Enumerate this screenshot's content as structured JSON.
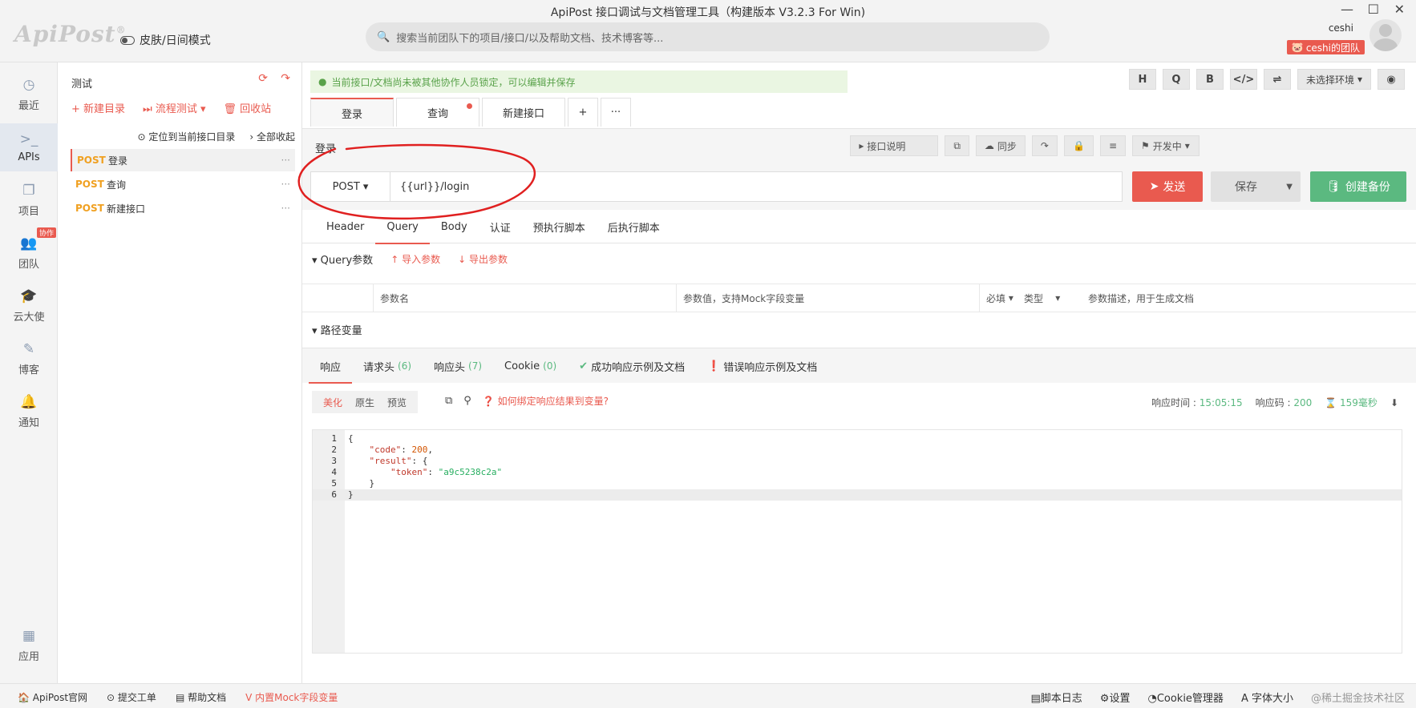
{
  "app": {
    "title": "ApiPost 接口调试与文档管理工具（构建版本 V3.2.3 For Win)",
    "logo": "ApiPost",
    "logo_mark": "®",
    "skin_mode": "皮肤/日间模式",
    "search_placeholder": "搜索当前团队下的项目/接口/以及帮助文档、技术博客等...",
    "user": "ceshi",
    "team_badge": "ceshi的团队",
    "win_controls": [
      "—",
      "☐",
      "✕"
    ]
  },
  "leftnav": {
    "items": [
      {
        "label": "最近",
        "icon": "clock-icon",
        "glyph": "◷"
      },
      {
        "label": "APIs",
        "icon": "terminal-icon",
        "glyph": ">_"
      },
      {
        "label": "项目",
        "icon": "project-icon",
        "glyph": "❐"
      },
      {
        "label": "团队",
        "icon": "team-icon",
        "glyph": "👥"
      },
      {
        "label": "云大使",
        "icon": "graduation-icon",
        "glyph": "🎓"
      },
      {
        "label": "博客",
        "icon": "edit-icon",
        "glyph": "✎"
      },
      {
        "label": "通知",
        "icon": "bell-icon",
        "glyph": "🔔"
      }
    ],
    "team_badge": "协作",
    "apps": {
      "label": "应用",
      "icon": "grid-icon",
      "glyph": "▦"
    }
  },
  "tree": {
    "project": "测试",
    "actions": [
      "+ 新建目录",
      "⏭ 流程测试 ▾",
      "🗑 回收站"
    ],
    "locate": "定位到当前接口目录",
    "collapse": "全部收起",
    "items": [
      {
        "method": "POST",
        "name": "登录",
        "selected": true
      },
      {
        "method": "POST",
        "name": "查询",
        "selected": false
      },
      {
        "method": "POST",
        "name": "新建接口",
        "selected": false
      }
    ]
  },
  "main": {
    "notice": "当前接口/文档尚未被其他协作人员锁定，可以编辑并保存",
    "toolbar": [
      "H",
      "Q",
      "B",
      "</>",
      "⇌"
    ],
    "env": "未选择环境",
    "tabs": [
      {
        "label": "登录",
        "active": true,
        "dot": false
      },
      {
        "label": "查询",
        "active": false,
        "dot": true
      },
      {
        "label": "新建接口",
        "active": false,
        "dot": false
      }
    ],
    "tab_add": "+",
    "tab_more": "···",
    "api_name": "登录",
    "subtools": {
      "doc": "接口说明",
      "sync": "同步",
      "status": "开发中"
    },
    "method": "POST",
    "url": "{{url}}/login",
    "send": "发送",
    "save": "保存",
    "backup": "创建备份",
    "req_tabs": [
      "Header",
      "Query",
      "Body",
      "认证",
      "预执行脚本",
      "后执行脚本"
    ],
    "req_active": 1,
    "query_title": "Query参数",
    "import": "导入参数",
    "export": "导出参数",
    "table": {
      "name": "参数名",
      "value": "参数值，支持Mock字段变量",
      "required": "必填",
      "type": "类型",
      "desc": "参数描述，用于生成文档"
    },
    "path_vars": "路径变量",
    "resp_tabs": [
      {
        "label": "响应",
        "count": ""
      },
      {
        "label": "请求头",
        "count": "(6)"
      },
      {
        "label": "响应头",
        "count": "(7)"
      },
      {
        "label": "Cookie",
        "count": "(0)"
      },
      {
        "label": "成功响应示例及文档",
        "count": ""
      },
      {
        "label": "错误响应示例及文档",
        "count": ""
      }
    ],
    "view_tabs": [
      "美化",
      "原生",
      "预览"
    ],
    "help": "如何绑定响应结果到变量?",
    "resp_time_label": "响应时间 :",
    "resp_time": "15:05:15",
    "resp_code_label": "响应码 :",
    "resp_code": "200",
    "duration": "159毫秒",
    "code_lines": [
      {
        "n": "1",
        "fold": true,
        "text": "{"
      },
      {
        "n": "2",
        "fold": false,
        "text": "    \"code\": 200,"
      },
      {
        "n": "3",
        "fold": true,
        "text": "    \"result\": {"
      },
      {
        "n": "4",
        "fold": false,
        "text": "        \"token\": \"a9c5238c2a\""
      },
      {
        "n": "5",
        "fold": false,
        "text": "    }"
      },
      {
        "n": "6",
        "fold": false,
        "text": "}"
      }
    ]
  },
  "statusbar": {
    "left": [
      "ApiPost官网",
      "提交工单",
      "帮助文档",
      "内置Mock字段变量"
    ],
    "right": [
      "脚本日志",
      "设置",
      "Cookie管理器",
      "字体大小",
      "@稀土掘金技术社区"
    ]
  },
  "colors": {
    "accent": "#e95a4f",
    "green": "#5bb980",
    "post": "#f0a020"
  }
}
